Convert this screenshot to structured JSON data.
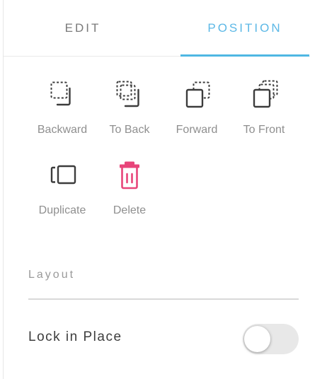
{
  "tabs": {
    "edit": "EDIT",
    "position": "POSITION",
    "active": "POSITION"
  },
  "actions": {
    "backward": {
      "label": "Backward",
      "icon": "send-backward-icon"
    },
    "to_back": {
      "label": "To Back",
      "icon": "send-to-back-icon"
    },
    "forward": {
      "label": "Forward",
      "icon": "bring-forward-icon"
    },
    "to_front": {
      "label": "To Front",
      "icon": "bring-to-front-icon"
    },
    "duplicate": {
      "label": "Duplicate",
      "icon": "duplicate-icon"
    },
    "delete": {
      "label": "Delete",
      "icon": "trash-icon"
    }
  },
  "layout": {
    "section_title": "Layout",
    "lock_label": "Lock in Place",
    "lock_enabled": false
  },
  "colors": {
    "accent": "#4fb7e3",
    "delete": "#e8457a",
    "icon": "#3c3c3c",
    "muted_text": "#8f8f8f"
  }
}
